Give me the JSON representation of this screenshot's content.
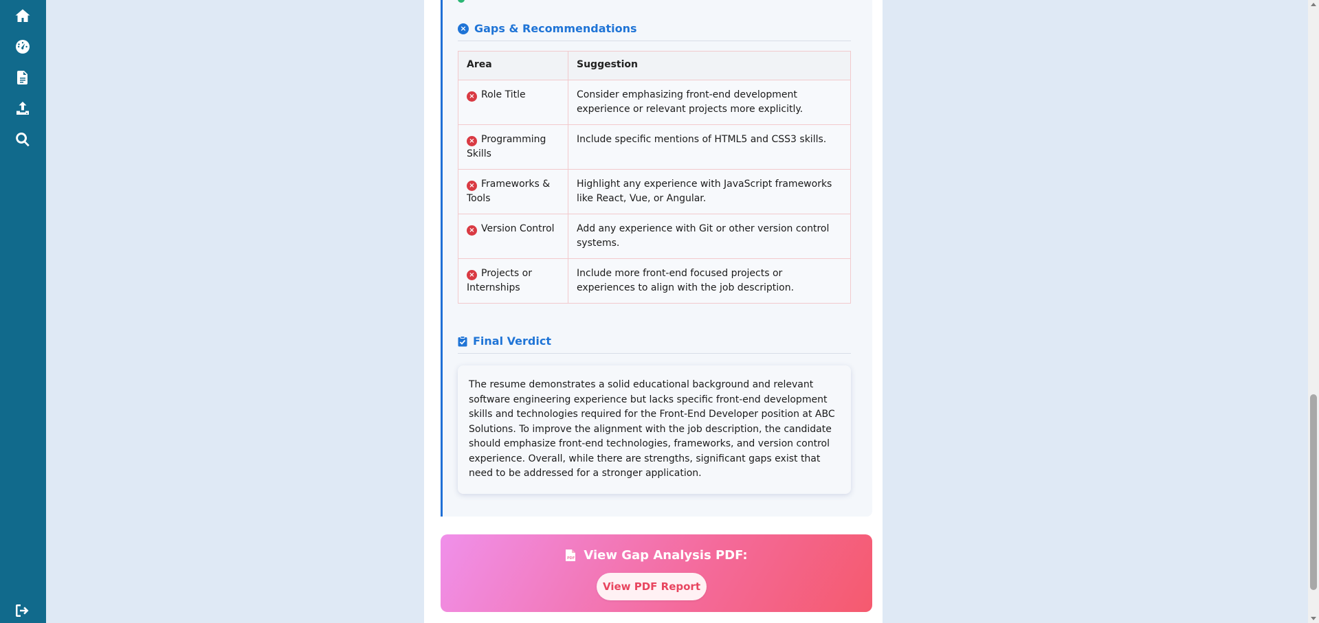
{
  "sidebar": {
    "icons": [
      "home-icon",
      "dashboard-icon",
      "document-icon",
      "upload-icon",
      "search-icon",
      "logout-icon"
    ]
  },
  "gaps": {
    "title": "Gaps & Recommendations",
    "headers": [
      "Area",
      "Suggestion"
    ],
    "rows": [
      {
        "area": "Role Title",
        "suggestion": "Consider emphasizing front-end development experience or relevant projects more explicitly."
      },
      {
        "area": "Programming Skills",
        "suggestion": "Include specific mentions of HTML5 and CSS3 skills."
      },
      {
        "area": "Frameworks & Tools",
        "suggestion": "Highlight any experience with JavaScript frameworks like React, Vue, or Angular."
      },
      {
        "area": "Version Control",
        "suggestion": "Add any experience with Git or other version control systems."
      },
      {
        "area": "Projects or Internships",
        "suggestion": "Include more front-end focused projects or experiences to align with the job description."
      }
    ]
  },
  "verdict": {
    "title": "Final Verdict",
    "text": "The resume demonstrates a solid educational background and relevant software engineering experience but lacks specific front-end development skills and technologies required for the Front-End Developer position at ABC Solutions. To improve the alignment with the job description, the candidate should emphasize front-end technologies, frameworks, and version control experience. Overall, while there are strengths, significant gaps exist that need to be addressed for a stronger application."
  },
  "pdf": {
    "title": "View Gap Analysis PDF:",
    "button_label": "View PDF Report"
  },
  "colors": {
    "sidebar": "#116a8c",
    "accent": "#1f74d6",
    "error": "#d93a43",
    "banner_start": "#f090ea",
    "banner_end": "#f55a6e"
  }
}
